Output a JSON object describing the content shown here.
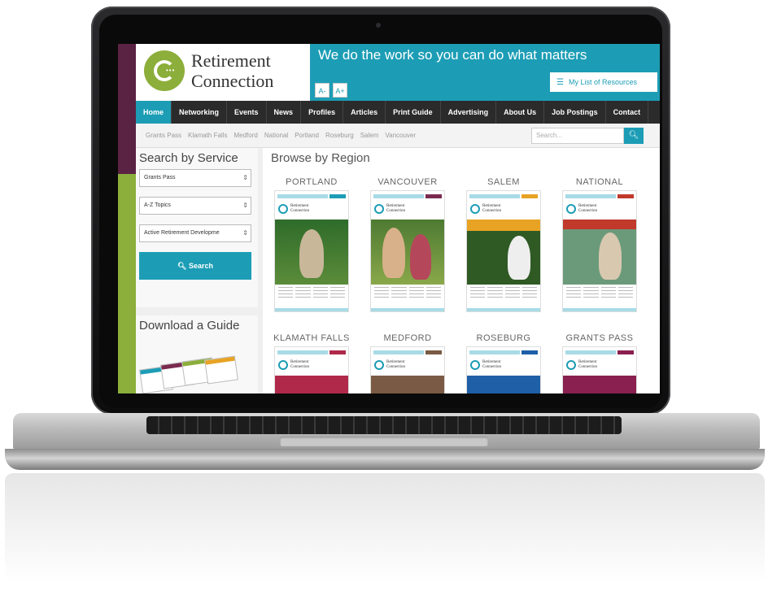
{
  "site": {
    "brand_line1": "Retirement",
    "brand_line2": "Connection",
    "tagline": "We do the work so you can do what matters",
    "font_decrease": "A-",
    "font_increase": "A+",
    "resources_label": "My List of Resources",
    "colors": {
      "teal": "#1c9db5",
      "green": "#8cae3a",
      "plum": "#5b2343",
      "nav": "#2b2b2b"
    }
  },
  "nav": {
    "items": [
      "Home",
      "Networking",
      "Events",
      "News",
      "Profiles",
      "Articles",
      "Print Guide",
      "Advertising",
      "About Us",
      "Job Postings",
      "Contact"
    ]
  },
  "subnav": {
    "links": [
      "Grants Pass",
      "Klamath Falls",
      "Medford",
      "National",
      "Portland",
      "Roseburg",
      "Salem",
      "Vancouver"
    ],
    "search_placeholder": "Search..."
  },
  "sidebar": {
    "search_title": "Search by Service",
    "select_region": "Grants Pass",
    "select_topics": "A-Z Topics",
    "select_service": "Active Retirement Developme",
    "search_button": "Search",
    "download_title": "Download a Guide"
  },
  "main": {
    "title": "Browse by Region",
    "regions": [
      {
        "name": "PORTLAND",
        "accent": "#1c9db5"
      },
      {
        "name": "VANCOUVER",
        "accent": "#7b2a4f"
      },
      {
        "name": "SALEM",
        "accent": "#e8a324"
      },
      {
        "name": "NATIONAL",
        "accent": "#c0392b"
      },
      {
        "name": "KLAMATH FALLS",
        "accent": "#b0294a"
      },
      {
        "name": "MEDFORD",
        "accent": "#7a5a44"
      },
      {
        "name": "ROSEBURG",
        "accent": "#1f5fa8"
      },
      {
        "name": "GRANTS PASS",
        "accent": "#8a2050"
      }
    ]
  }
}
